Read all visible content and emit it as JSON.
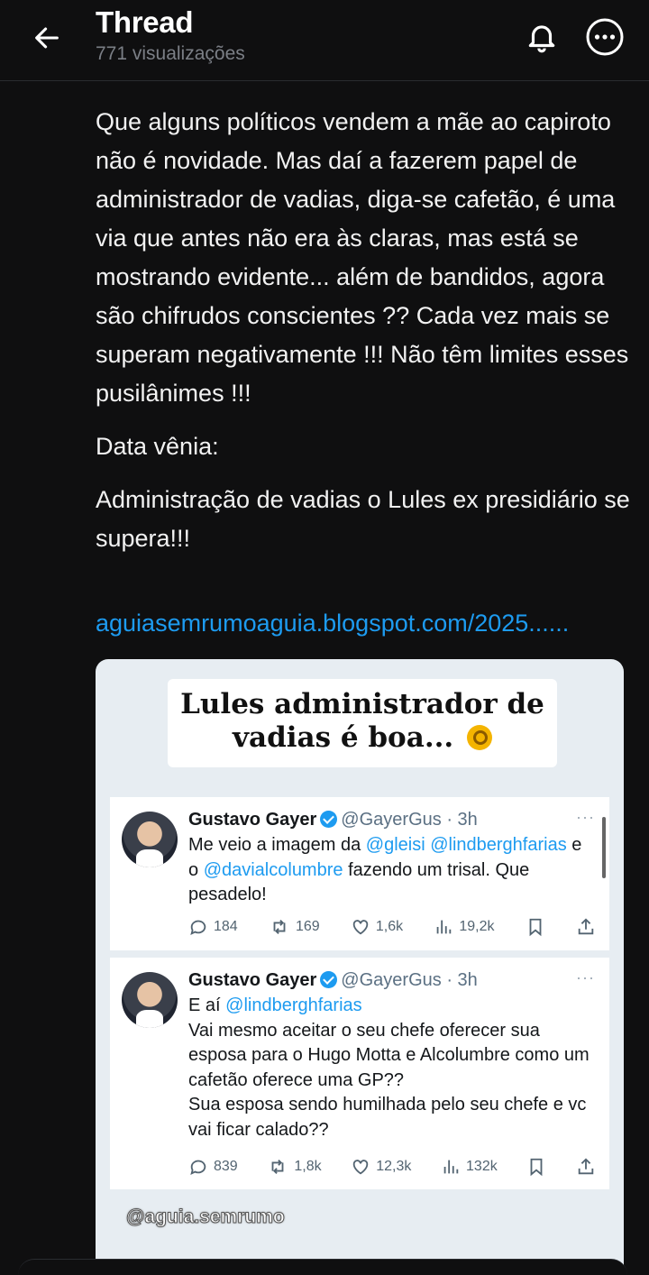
{
  "header": {
    "title": "Thread",
    "views": "771 visualizações",
    "back_icon": "arrow-left-icon",
    "bell_icon": "bell-icon",
    "more_icon": "more-horizontal-icon"
  },
  "post": {
    "paragraphs": [
      "Que alguns políticos vendem a mãe ao capiroto não é novidade. Mas daí a fazerem papel de administrador de vadias, diga-se cafetão, é uma via que antes não era às claras, mas está se mostrando evidente... além de bandidos, agora são chifrudos conscientes ?? Cada vez mais se superam negativamente !!! Não têm limites esses pusilânimes !!!",
      "Data vênia:",
      "Administração de vadias o Lules ex presidiário se supera!!!"
    ],
    "link": "aguiasemrumoaguia.blogspot.com/2025......"
  },
  "media": {
    "headline_line1": "Lules administrador de",
    "headline_line2": "vadias é boa...",
    "watermark": "@aguia.semrumo",
    "tweets": [
      {
        "name": "Gustavo Gayer",
        "handle": "@GayerGus",
        "time": "· 3h",
        "more": "···",
        "text_before": "Me veio a imagem da ",
        "mention1": "@gleisi",
        "text_mid": " ",
        "mention2": "@lindberghfarias",
        "text_mid2": " e o ",
        "mention3": "@davialcolumbre",
        "text_after": " fazendo um trisal. Que pesadelo!",
        "replies": "184",
        "retweets": "169",
        "likes": "1,6k",
        "views": "19,2k"
      },
      {
        "name": "Gustavo Gayer",
        "handle": "@GayerGus",
        "time": "· 3h",
        "more": "···",
        "line1": "E aí ",
        "mention1": "@lindberghfarias",
        "body": "Vai mesmo aceitar o seu chefe oferecer sua esposa para o Hugo Motta e Alcolumbre como um cafetão oferece uma GP??",
        "body2": "Sua esposa sendo humilhada pelo seu chefe e vc vai ficar calado??",
        "replies": "839",
        "retweets": "1,8k",
        "likes": "12,3k",
        "views": "132k"
      }
    ]
  },
  "colors": {
    "background": "#0f0f10",
    "link": "#1d9bf0",
    "muted": "#7b7f86"
  }
}
